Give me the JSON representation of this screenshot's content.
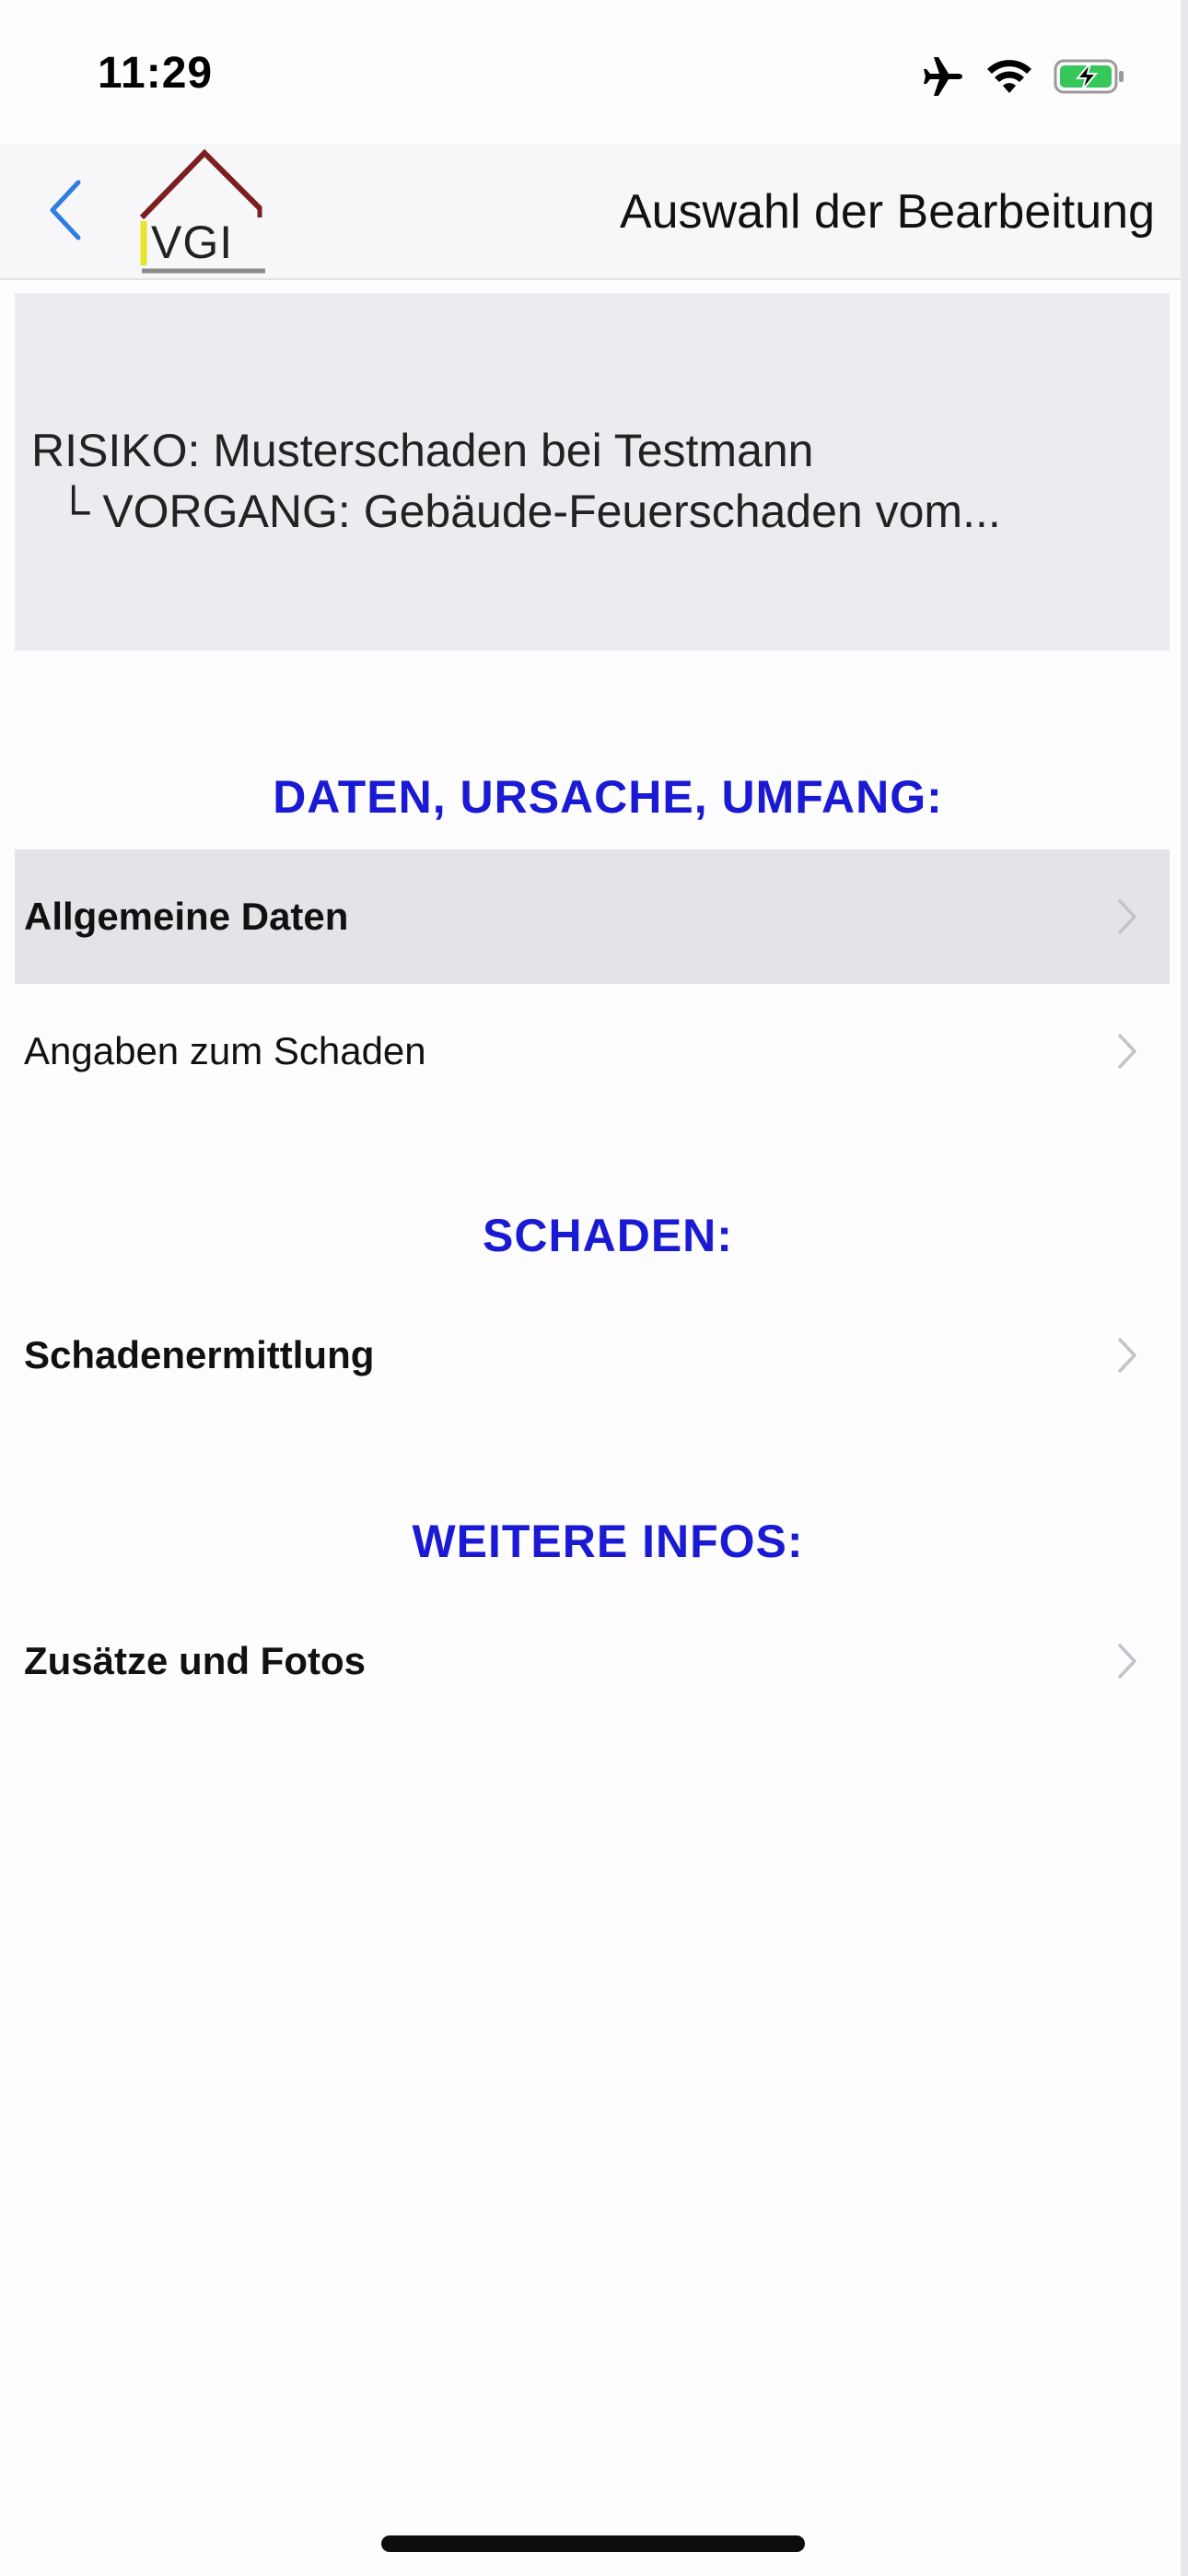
{
  "status_bar": {
    "time": "11:29",
    "icons": [
      "airplane-icon",
      "wifi-icon",
      "battery-charging-icon"
    ]
  },
  "nav": {
    "back_icon": "chevron-left-icon",
    "logo_text": "VGI",
    "title": "Auswahl der Bearbeitung"
  },
  "info": {
    "line1": "RISIKO: Musterschaden bei Testmann",
    "line2": "└ VORGANG: Gebäude-Feuerschaden vom..."
  },
  "sections": [
    {
      "title": "DATEN, URSACHE, UMFANG:",
      "items": [
        {
          "label": "Allgemeine Daten",
          "bold": true,
          "selected": true
        },
        {
          "label": "Angaben zum Schaden",
          "bold": false,
          "selected": false
        }
      ]
    },
    {
      "title": "SCHADEN:",
      "items": [
        {
          "label": "Schadenermittlung",
          "bold": true,
          "selected": false
        }
      ]
    },
    {
      "title": "WEITERE INFOS:",
      "items": [
        {
          "label": "Zusätze und Fotos",
          "bold": true,
          "selected": false
        }
      ]
    }
  ],
  "colors": {
    "section_header": "#1a1ad4",
    "back_chevron": "#2f7de0",
    "logo_roof": "#7a1e22",
    "logo_accent": "#e6e629",
    "selected_row": "#e4e3e8",
    "info_box": "#ecebf0"
  }
}
